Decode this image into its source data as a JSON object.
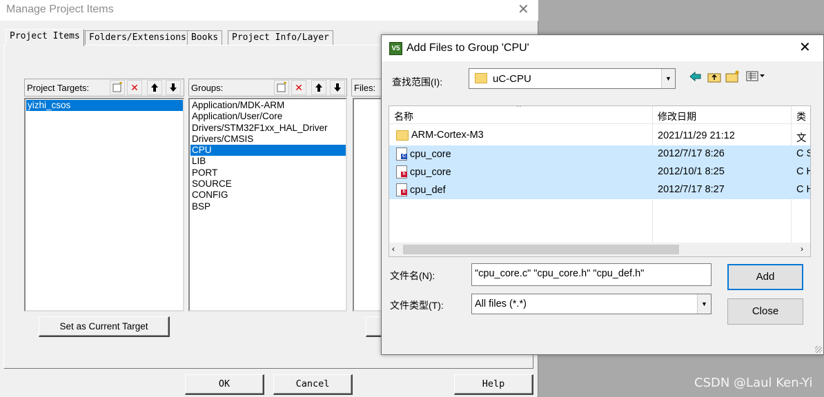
{
  "manage": {
    "title": "Manage Project Items",
    "close_glyph": "✕",
    "tabs": [
      "Project Items",
      "Folders/Extensions",
      "Books",
      "Project Info/Layer"
    ],
    "targets": {
      "label": "Project Targets:",
      "items": [
        "yizhi_csos"
      ],
      "selected": 0
    },
    "groups": {
      "label": "Groups:",
      "items": [
        "Application/MDK-ARM",
        "Application/User/Core",
        "Drivers/STM32F1xx_HAL_Driver",
        "Drivers/CMSIS",
        "CPU",
        "LIB",
        "PORT",
        "SOURCE",
        "CONFIG",
        "BSP"
      ],
      "selected": 4
    },
    "files": {
      "label": "Files:"
    },
    "set_current_target": "Set as Current Target",
    "ok": "OK",
    "cancel": "Cancel",
    "help": "Help"
  },
  "addfiles": {
    "title": "Add Files to Group 'CPU'",
    "app_icon": "V5",
    "close_glyph": "✕",
    "lookin_label": "查找范围(I):",
    "lookin_value": "uC-CPU",
    "columns": {
      "name": "名称",
      "date": "修改日期",
      "type": "类"
    },
    "rows": [
      {
        "name": "ARM-Cortex-M3",
        "date": "2021/11/29 21:12",
        "type": "文",
        "icon": "folder-icon",
        "selected": false
      },
      {
        "name": "cpu_core",
        "date": "2012/7/17 8:26",
        "type": "C S",
        "icon": "c-source-file-icon",
        "selected": true
      },
      {
        "name": "cpu_core",
        "date": "2012/10/1 8:25",
        "type": "C H",
        "icon": "c-header-file-icon",
        "selected": true
      },
      {
        "name": "cpu_def",
        "date": "2012/7/17 8:27",
        "type": "C H",
        "icon": "c-header-file-icon",
        "selected": true
      }
    ],
    "filename_label": "文件名(N):",
    "filename_value": "\"cpu_core.c\" \"cpu_core.h\" \"cpu_def.h\"",
    "filetype_label": "文件类型(T):",
    "filetype_value": "All files (*.*)",
    "add": "Add",
    "close": "Close"
  },
  "watermark": "CSDN @Laul Ken-Yi",
  "colors": {
    "selection": "#0078d7",
    "list_selection": "#cce8ff",
    "folder": "#f8d775"
  }
}
